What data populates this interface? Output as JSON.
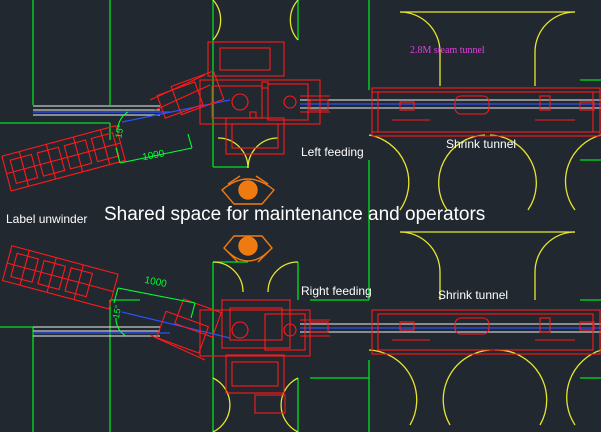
{
  "labels": {
    "label_unwinder": "Label unwinder",
    "shared_space": "Shared space for maintenance and operators",
    "left_feeding": "Left feeding",
    "right_feeding": "Right feeding",
    "shrink_tunnel_top": "Shrink tunnel",
    "shrink_tunnel_bottom": "Shrink tunnel",
    "steam_tunnel": "2.8M steam tunnel"
  },
  "dimensions": {
    "top_length": "1000",
    "top_angle": "15°",
    "bottom_length": "1000",
    "bottom_angle": "15°"
  },
  "colors": {
    "background": "#212830",
    "machine": "#ff1a1a",
    "guard": "#00e020",
    "door_arc": "#e6e62e",
    "conveyor": "#c8c8c8",
    "centerline": "#2a52ff",
    "operator": "#f07a12",
    "dimension": "#00ff30",
    "steam_text": "#e040e0"
  }
}
